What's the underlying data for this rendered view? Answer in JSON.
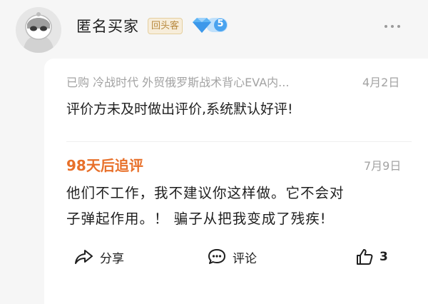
{
  "header": {
    "username": "匿名买家",
    "tag": "回头客",
    "level": "5",
    "colors": {
      "tag_text": "#b8893f",
      "tag_bg": "#f7edda",
      "diamond": "#4aa3ef"
    }
  },
  "review": {
    "order_info": "已购  冷战时代  外贸俄罗斯战术背心EVA内...",
    "date": "4月2日",
    "text": "评价方未及时做出评价,系统默认好评!"
  },
  "followup": {
    "title": "98天后追评",
    "date": "7月9日",
    "line1": "他们不工作，我不建议你这样做。它不会对",
    "line2": "子弹起作用。！ 骗子从把我变成了残疾!",
    "color": "#e8702a"
  },
  "actions": {
    "share_label": "分享",
    "comment_label": "评论",
    "like_count": "3"
  }
}
